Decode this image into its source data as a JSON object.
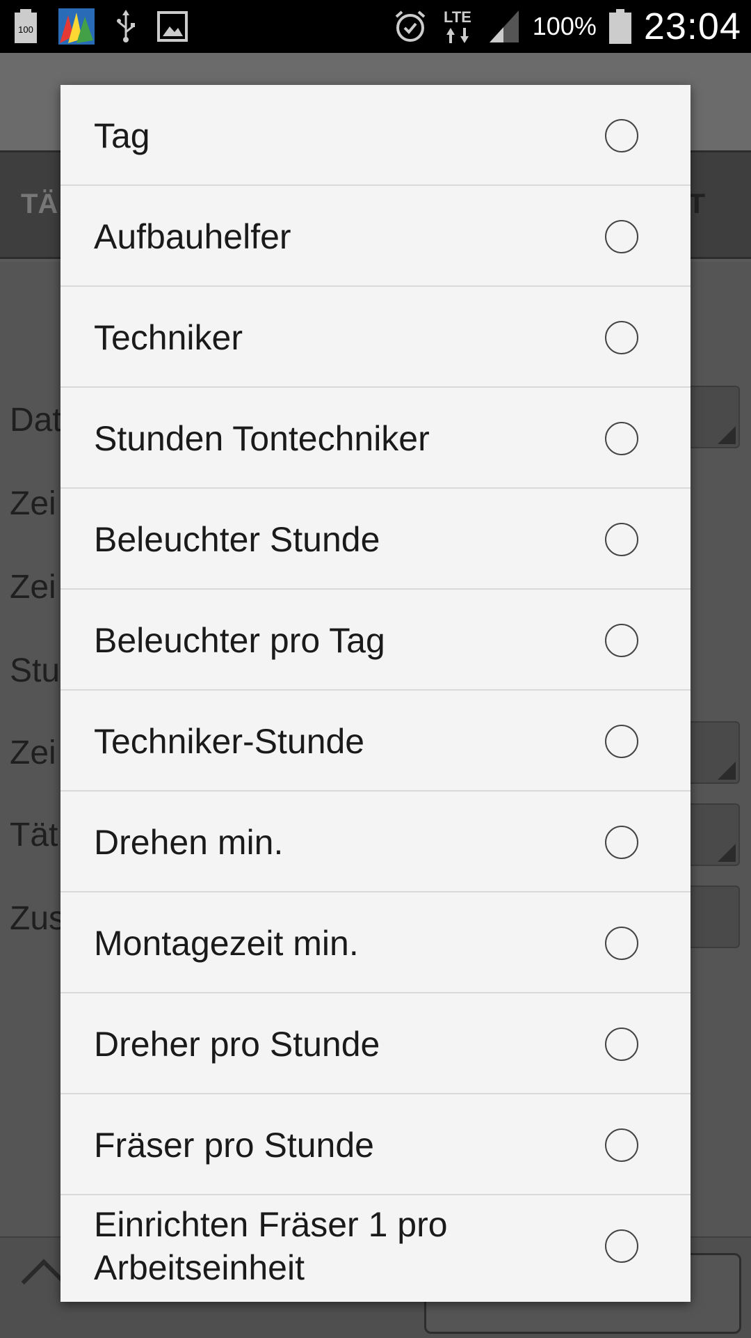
{
  "status_bar": {
    "left_icons": [
      "battery-saver-icon",
      "avg-antivirus-icon",
      "usb-icon",
      "image-icon"
    ],
    "battery_saver_text": "100",
    "network": "LTE",
    "battery_percent": "100%",
    "time": "23:04"
  },
  "background_app": {
    "tab_left_partial": "TÄ",
    "tab_right_partial": "T",
    "form_labels_partial": [
      "Dat",
      "Zei",
      "Zei",
      "Stu",
      "Zei",
      "Tät",
      "Zus"
    ]
  },
  "dialog": {
    "options": [
      {
        "label": "Tag",
        "selected": false
      },
      {
        "label": "Aufbauhelfer",
        "selected": false
      },
      {
        "label": "Techniker",
        "selected": false
      },
      {
        "label": "Stunden Tontechniker",
        "selected": false
      },
      {
        "label": "Beleuchter Stunde",
        "selected": false
      },
      {
        "label": "Beleuchter pro Tag",
        "selected": false
      },
      {
        "label": "Techniker-Stunde",
        "selected": false
      },
      {
        "label": "Drehen min.",
        "selected": false
      },
      {
        "label": "Montagezeit min.",
        "selected": false
      },
      {
        "label": "Dreher pro Stunde",
        "selected": false
      },
      {
        "label": "Fräser pro Stunde",
        "selected": false
      },
      {
        "label": "Einrichten Fräser 1 pro Arbeitseinheit",
        "selected": false
      }
    ]
  }
}
